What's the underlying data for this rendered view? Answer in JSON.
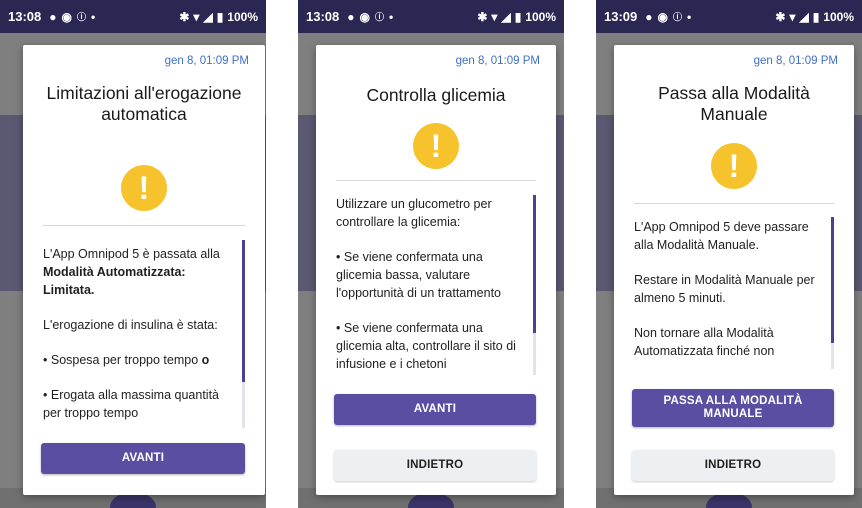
{
  "screens": [
    {
      "status": {
        "time": "13:08",
        "battery": "100%"
      },
      "timestamp": "gen 8, 01:09 PM",
      "title": "Limitazioni all'erogazione automatica",
      "body": {
        "p1_prefix": "L'App Omnipod 5 è passata alla ",
        "p1_bold": "Modalità Automatizzata: Limitata.",
        "p2": "L'erogazione di insulina è stata:",
        "b1_text": "Sospesa per troppo tempo ",
        "b1_bold": "o",
        "b2": "Erogata alla massima quantità per troppo tempo"
      },
      "primary_button": "AVANTI"
    },
    {
      "status": {
        "time": "13:08",
        "battery": "100%"
      },
      "timestamp": "gen 8, 01:09 PM",
      "title": "Controlla glicemia",
      "body": {
        "p1": "Utilizzare un glucometro per controllare la glicemia:",
        "b1": "Se viene confermata una glicemia bassa, valutare l'opportunità di un trattamento",
        "b2": "Se viene confermata una glicemia alta, controllare il sito di infusione e i chetoni"
      },
      "primary_button": "AVANTI",
      "secondary_button": "INDIETRO"
    },
    {
      "status": {
        "time": "13:09",
        "battery": "100%"
      },
      "timestamp": "gen 8, 01:09 PM",
      "title": "Passa alla Modalità Manuale",
      "body": {
        "p1": "L'App Omnipod 5 deve passare alla Modalità Manuale.",
        "p2": "Restare in Modalità Manuale per almeno 5 minuti.",
        "p3": "Non tornare alla Modalità Automatizzata finché non"
      },
      "primary_button": "PASSA ALLA MODALITÀ MANUALE",
      "secondary_button": "INDIETRO"
    }
  ],
  "colors": {
    "accent": "#5a4ea3",
    "timestamp": "#3f6fc7",
    "warning": "#f7c32d",
    "status_bar": "#2a2752"
  },
  "icons": [
    "warning-icon",
    "alarm-clock-icon",
    "notification-icon",
    "bluetooth-icon",
    "vibrate-icon",
    "wifi-icon",
    "signal-icon",
    "battery-icon"
  ]
}
